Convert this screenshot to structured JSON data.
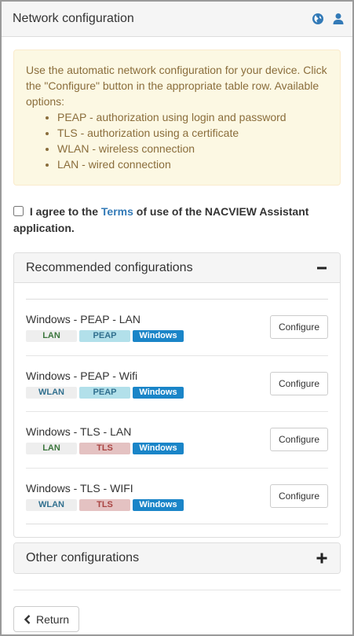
{
  "header": {
    "title": "Network configuration",
    "icons": [
      "globe-icon",
      "user-icon"
    ],
    "accent_color": "#337ab7"
  },
  "alert": {
    "intro": "Use the automatic network configuration for your device. Click the \"Configure\" button in the appropriate table row. Available options:",
    "options": [
      "PEAP - authorization using login and password",
      "TLS - authorization using a certificate",
      "WLAN - wireless connection",
      "LAN - wired connection"
    ]
  },
  "agree": {
    "before": "I agree to the",
    "link": "Terms",
    "after": "of use of the NACVIEW Assistant application.",
    "checked": false
  },
  "recommended": {
    "title": "Recommended configurations",
    "toggle": "−",
    "items": [
      {
        "name": "Windows - PEAP - LAN",
        "tags": [
          "LAN",
          "PEAP",
          "Windows"
        ],
        "button": "Configure"
      },
      {
        "name": "Windows - PEAP - Wifi",
        "tags": [
          "WLAN",
          "PEAP",
          "Windows"
        ],
        "button": "Configure"
      },
      {
        "name": "Windows - TLS - LAN",
        "tags": [
          "LAN",
          "TLS",
          "Windows"
        ],
        "button": "Configure"
      },
      {
        "name": "Windows - TLS - WIFI",
        "tags": [
          "WLAN",
          "TLS",
          "Windows"
        ],
        "button": "Configure"
      }
    ]
  },
  "other": {
    "title": "Other configurations",
    "toggle": "+"
  },
  "footer": {
    "return_label": "Return"
  }
}
